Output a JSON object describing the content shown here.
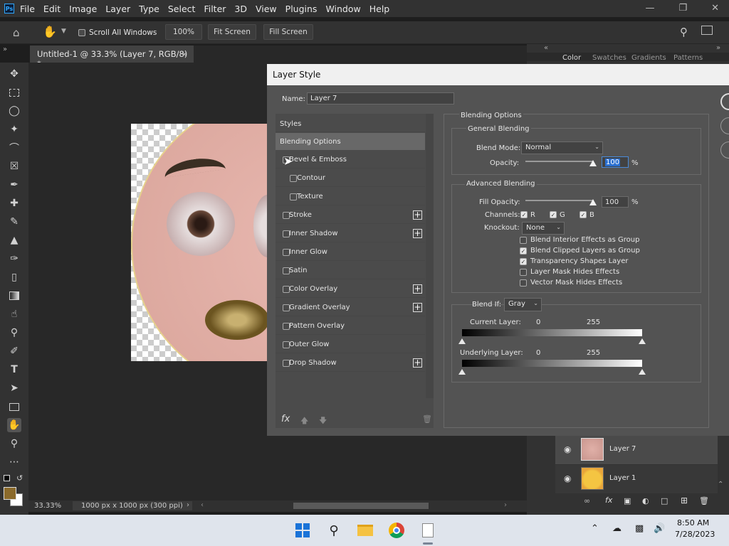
{
  "menubar": {
    "logo": "Ps",
    "items": [
      "File",
      "Edit",
      "Image",
      "Layer",
      "Type",
      "Select",
      "Filter",
      "3D",
      "View",
      "Plugins",
      "Window",
      "Help"
    ]
  },
  "options": {
    "scroll_all_windows": "Scroll All Windows",
    "zoom": "100%",
    "fit_screen": "Fit Screen",
    "fill_screen": "Fill Screen"
  },
  "document": {
    "tab_title": "Untitled-1 @ 33.3% (Layer 7, RGB/8) *",
    "zoom": "33.33%",
    "doc_info": "1000 px x 1000 px (300 ppi)"
  },
  "right_panel": {
    "tabs": [
      "Color",
      "Swatches",
      "Gradients",
      "Patterns"
    ],
    "layers": [
      {
        "name": "Layer 7"
      },
      {
        "name": "Layer 1"
      }
    ]
  },
  "dialog": {
    "title": "Layer Style",
    "name_label": "Name:",
    "name_value": "Layer 7",
    "styles_header": "Styles",
    "blending_options_item": "Blending Options",
    "style_items": [
      {
        "label": "Bevel & Emboss",
        "plus": false
      },
      {
        "label": "Contour",
        "plus": false
      },
      {
        "label": "Texture",
        "plus": false
      },
      {
        "label": "Stroke",
        "plus": true
      },
      {
        "label": "Inner Shadow",
        "plus": true
      },
      {
        "label": "Inner Glow",
        "plus": false
      },
      {
        "label": "Satin",
        "plus": false
      },
      {
        "label": "Color Overlay",
        "plus": true
      },
      {
        "label": "Gradient Overlay",
        "plus": true
      },
      {
        "label": "Pattern Overlay",
        "plus": false
      },
      {
        "label": "Outer Glow",
        "plus": false
      },
      {
        "label": "Drop Shadow",
        "plus": true
      }
    ],
    "fx_label": "fx",
    "blending": {
      "section": "Blending Options",
      "general": "General Blending",
      "blend_mode_label": "Blend Mode:",
      "blend_mode": "Normal",
      "opacity_label": "Opacity:",
      "opacity": "100",
      "pct": "%",
      "advanced": "Advanced Blending",
      "fill_opacity_label": "Fill Opacity:",
      "fill_opacity": "100",
      "channels_label": "Channels:",
      "channels": [
        "R",
        "G",
        "B"
      ],
      "knockout_label": "Knockout:",
      "knockout": "None",
      "options": [
        {
          "label": "Blend Interior Effects as Group",
          "checked": false
        },
        {
          "label": "Blend Clipped Layers as Group",
          "checked": true
        },
        {
          "label": "Transparency Shapes Layer",
          "checked": true
        },
        {
          "label": "Layer Mask Hides Effects",
          "checked": false
        },
        {
          "label": "Vector Mask Hides Effects",
          "checked": false
        }
      ],
      "blend_if_label": "Blend If:",
      "blend_if": "Gray",
      "current_layer": "Current Layer:",
      "underlying_layer": "Underlying Layer:",
      "min": "0",
      "max": "255"
    }
  },
  "taskbar": {
    "time": "8:50 AM",
    "date": "7/28/2023"
  }
}
